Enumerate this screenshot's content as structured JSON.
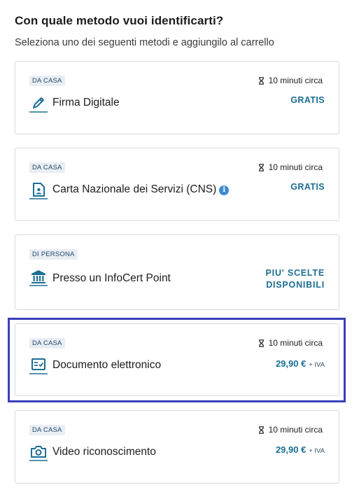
{
  "header": {
    "title": "Con quale metodo vuoi identificarti?",
    "subtitle": "Seleziona uno dei seguenti metodi e aggiungilo al carrello"
  },
  "methods": [
    {
      "badge": "DA CASA",
      "label": "Firma Digitale",
      "icon": "pen-icon",
      "time": "10 minuti circa",
      "price": "GRATIS"
    },
    {
      "badge": "DA CASA",
      "label": "Carta Nazionale dei Servizi (CNS)",
      "icon": "id-card-icon",
      "info_icon": "i",
      "time": "10 minuti circa",
      "price": "GRATIS"
    },
    {
      "badge": "DI PERSONA",
      "label": "Presso un InfoCert Point",
      "icon": "bank-icon",
      "price_line1": "PIU' SCELTE",
      "price_line2": "DISPONIBILI"
    },
    {
      "badge": "DA CASA",
      "label": "Documento elettronico",
      "icon": "document-check-icon",
      "time": "10 minuti circa",
      "price_amount": "29,90 €",
      "price_suffix": "+ IVA",
      "selected": true
    },
    {
      "badge": "DA CASA",
      "label": "Video riconoscimento",
      "icon": "camera-icon",
      "time": "10 minuti circa",
      "price_amount": "29,90 €",
      "price_suffix": "+ IVA"
    }
  ],
  "colors": {
    "accent": "#1b6e94",
    "selected_border": "#3a3fb8",
    "badge_bg": "#e8eef4",
    "card_border": "#d6dbe0"
  }
}
